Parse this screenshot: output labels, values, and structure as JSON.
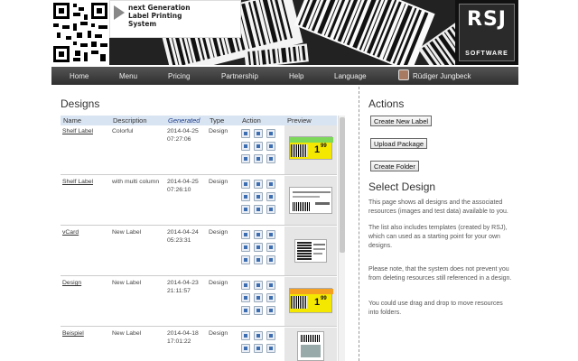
{
  "banner": {
    "tagline": "next Generation\nLabel Printing\nSystem",
    "logo_main": "RSJ",
    "logo_sub": "SOFTWARE"
  },
  "nav": {
    "items": [
      "Home",
      "Menu",
      "Pricing",
      "Partnership",
      "Help",
      "Language"
    ],
    "user": "Rüdiger Jungbeck"
  },
  "main": {
    "title": "Designs",
    "columns": [
      "Name",
      "Description",
      "Generated",
      "Type",
      "Action",
      "Preview"
    ],
    "rows": [
      {
        "name": "Shelf Label",
        "description": "Colorful",
        "date": "2014-04-25",
        "time": "07:27:06",
        "type": "Design"
      },
      {
        "name": "Shelf Label",
        "description": "with multi column",
        "date": "2014-04-25",
        "time": "07:26:10",
        "type": "Design"
      },
      {
        "name": "vCard",
        "description": "New Label",
        "date": "2014-04-24",
        "time": "05:23:31",
        "type": "Design"
      },
      {
        "name": "Design",
        "description": "New Label",
        "date": "2014-04-23",
        "time": "21:11:57",
        "type": "Design"
      },
      {
        "name": "Beispiel",
        "description": "New Label",
        "date": "2014-04-18",
        "time": "17:01:22",
        "type": "Design"
      }
    ],
    "preview_price": "1",
    "preview_price_sup": "99"
  },
  "right": {
    "actions_title": "Actions",
    "create_label": "Create New Label",
    "upload_package": "Upload Package",
    "create_folder": "Create Folder",
    "select_title": "Select Design",
    "p1": "This page shows all designs and the associated resources (images and test data) available to you.",
    "p2": "The list also includes templates (created by RSJ), which can used as a starting point for your own designs.",
    "p3": "Please note, that the system does not prevent you from deleting resources still referenced in a design.",
    "p4": "You could use drag and drop to move resources into folders."
  },
  "colors": {
    "nav_bg": "#3a3a3a",
    "header_bg": "#d9e4f2",
    "price_yellow": "#f5e800",
    "price_green": "#7dd85a",
    "price_orange": "#f5a020"
  }
}
